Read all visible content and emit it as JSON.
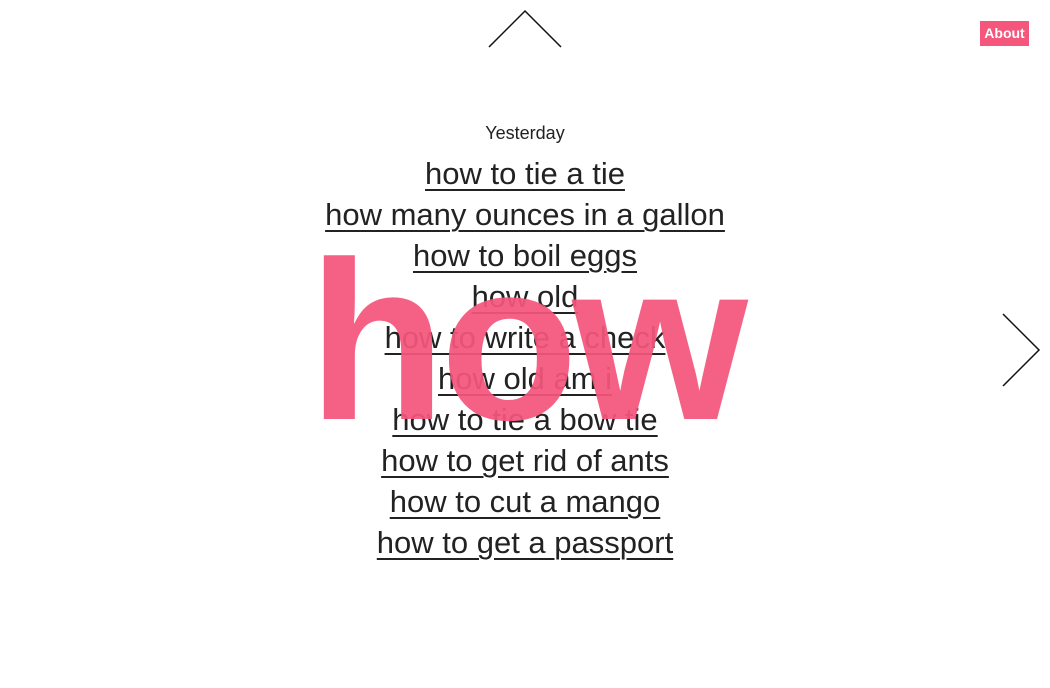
{
  "header": {
    "about_label": "About"
  },
  "navigation": {
    "up_icon": "chevron-up-icon",
    "right_icon": "chevron-right-icon"
  },
  "hero": {
    "word": "how",
    "color": "#f4567c"
  },
  "section": {
    "date_label": "Yesterday"
  },
  "results": [
    "how to tie a tie",
    "how many ounces in a gallon",
    "how to boil eggs",
    "how old",
    "how to write a check",
    "how old am i",
    "how to tie a bow tie",
    "how to get rid of ants",
    "how to cut a mango",
    "how to get a passport"
  ],
  "colors": {
    "accent": "#f4567c",
    "text": "#222222",
    "background": "#ffffff"
  }
}
